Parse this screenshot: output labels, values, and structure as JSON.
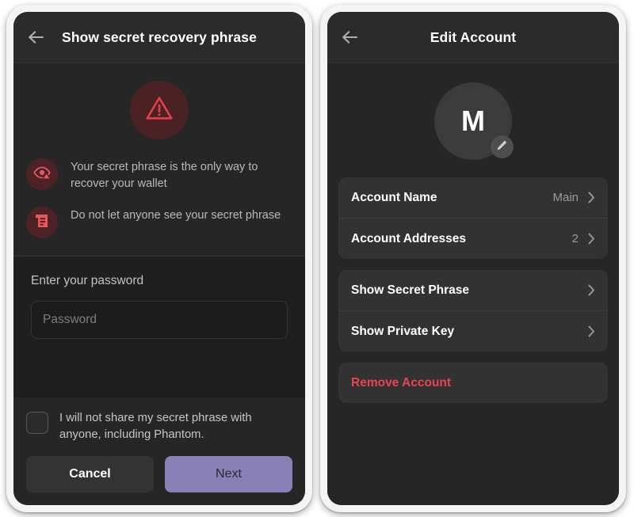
{
  "left_panel": {
    "header": {
      "back_icon": "arrow-left-icon",
      "title": "Show secret recovery phrase"
    },
    "warning_icon": "warning-triangle-icon",
    "bullets": [
      {
        "icon": "eye-warning-icon",
        "text": "Your secret phrase is the only way to recover your wallet"
      },
      {
        "icon": "scroll-document-icon",
        "text": "Do not let anyone see your secret phrase"
      }
    ],
    "password": {
      "label": "Enter your password",
      "placeholder": "Password",
      "value": ""
    },
    "consent": {
      "checked": false,
      "text": "I will not share my secret phrase with anyone, including Phantom."
    },
    "buttons": {
      "cancel_label": "Cancel",
      "next_label": "Next"
    }
  },
  "right_panel": {
    "header": {
      "back_icon": "arrow-left-icon",
      "title": "Edit Account"
    },
    "avatar": {
      "initial": "M",
      "edit_icon": "pencil-icon"
    },
    "groups": [
      {
        "rows": [
          {
            "label": "Account Name",
            "value": "Main",
            "chevron": true,
            "danger": false
          },
          {
            "label": "Account Addresses",
            "value": "2",
            "chevron": true,
            "danger": false
          }
        ]
      },
      {
        "rows": [
          {
            "label": "Show Secret Phrase",
            "value": "",
            "chevron": true,
            "danger": false
          },
          {
            "label": "Show Private Key",
            "value": "",
            "chevron": true,
            "danger": false
          }
        ]
      },
      {
        "rows": [
          {
            "label": "Remove Account",
            "value": "",
            "chevron": false,
            "danger": true
          }
        ]
      }
    ]
  },
  "colors": {
    "screen_background": "#262626",
    "titlebar": "#2b2b2b",
    "card": "#323232",
    "password_zone": "#1f1f1f",
    "input": "#1c1c1c",
    "accent_purple": "#8a80b8",
    "danger_red": "#e8434f",
    "icon_badge_red": "#4d2226",
    "text_primary": "#ffffff",
    "text_secondary": "#b9b9b9"
  }
}
